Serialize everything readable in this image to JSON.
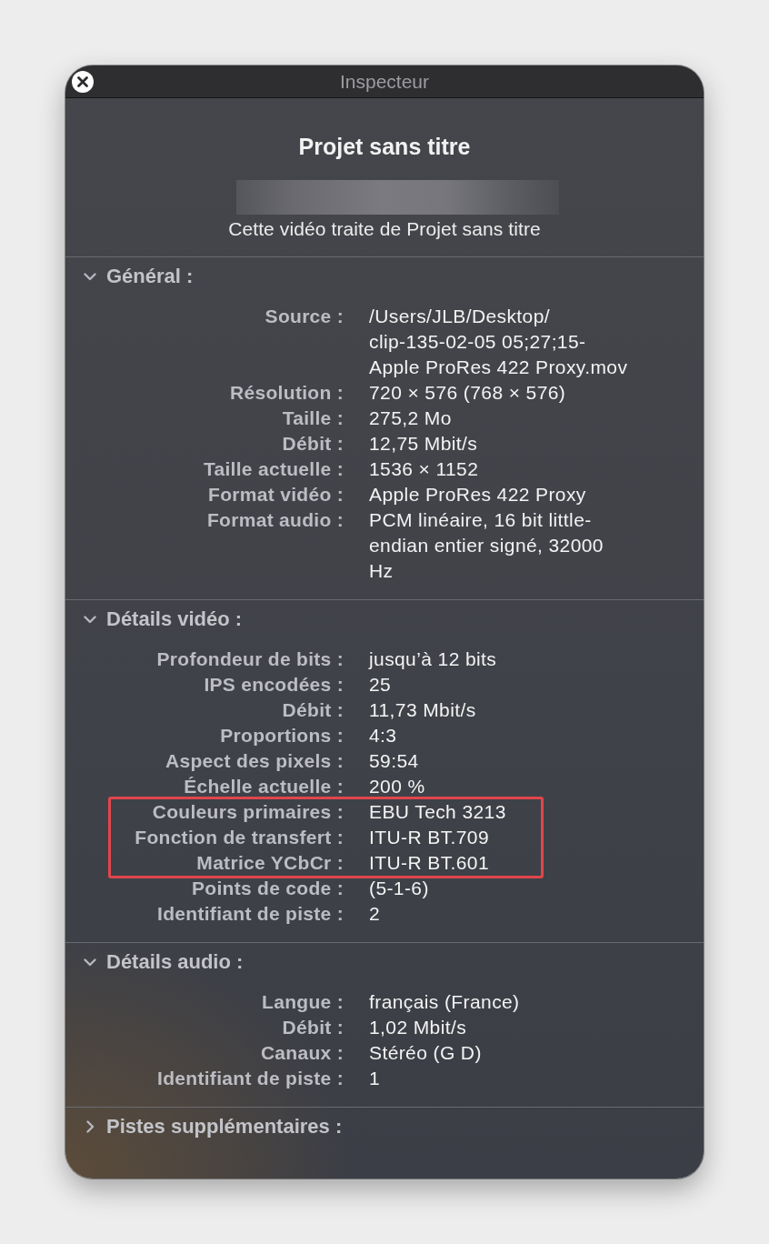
{
  "window": {
    "title": "Inspecteur"
  },
  "header": {
    "title": "Projet sans titre",
    "subtitle": "Cette vidéo traite de Projet sans titre"
  },
  "sections": [
    {
      "title": "Général :",
      "expanded": true,
      "rows": [
        {
          "label": "Source :",
          "value": [
            "/Users/JLB/Desktop/",
            "clip-135-02-05 05;27;15-",
            "Apple ProRes 422 Proxy.mov"
          ],
          "highlighted": false
        },
        {
          "label": "Résolution :",
          "value": "720 × 576 (768 × 576)",
          "highlighted": false
        },
        {
          "label": "Taille :",
          "value": "275,2 Mo",
          "highlighted": false
        },
        {
          "label": "Débit :",
          "value": "12,75 Mbit/s",
          "highlighted": false
        },
        {
          "label": "Taille actuelle :",
          "value": "1536 × 1152",
          "highlighted": false
        },
        {
          "label": "Format vidéo :",
          "value": "Apple ProRes 422 Proxy",
          "highlighted": false
        },
        {
          "label": "Format audio :",
          "value": [
            "PCM linéaire, 16 bit little-",
            "endian entier signé, 32000",
            "Hz"
          ],
          "highlighted": false
        }
      ]
    },
    {
      "title": "Détails vidéo :",
      "expanded": true,
      "rows": [
        {
          "label": "Profondeur de bits :",
          "value": "jusqu’à 12 bits",
          "highlighted": false
        },
        {
          "label": "IPS encodées :",
          "value": "25",
          "highlighted": false
        },
        {
          "label": "Débit :",
          "value": "11,73 Mbit/s",
          "highlighted": false
        },
        {
          "label": "Proportions :",
          "value": "4:3",
          "highlighted": false
        },
        {
          "label": "Aspect des pixels :",
          "value": "59:54",
          "highlighted": false
        },
        {
          "label": "Échelle actuelle :",
          "value": "200 %",
          "highlighted": false
        },
        {
          "label": "Couleurs primaires :",
          "value": "EBU Tech 3213",
          "highlighted": true
        },
        {
          "label": "Fonction de transfert :",
          "value": "ITU-R BT.709",
          "highlighted": true
        },
        {
          "label": "Matrice YCbCr :",
          "value": "ITU-R BT.601",
          "highlighted": true
        },
        {
          "label": "Points de code :",
          "value": "(5-1-6)",
          "highlighted": false
        },
        {
          "label": "Identifiant de piste :",
          "value": "2",
          "highlighted": false
        }
      ]
    },
    {
      "title": "Détails audio :",
      "expanded": true,
      "rows": [
        {
          "label": "Langue :",
          "value": "français (France)",
          "highlighted": false
        },
        {
          "label": "Débit :",
          "value": "1,02 Mbit/s",
          "highlighted": false
        },
        {
          "label": "Canaux :",
          "value": "Stéréo (G D)",
          "highlighted": false
        },
        {
          "label": "Identifiant de piste :",
          "value": "1",
          "highlighted": false
        }
      ]
    },
    {
      "title": "Pistes supplémentaires :",
      "expanded": false
    }
  ]
}
